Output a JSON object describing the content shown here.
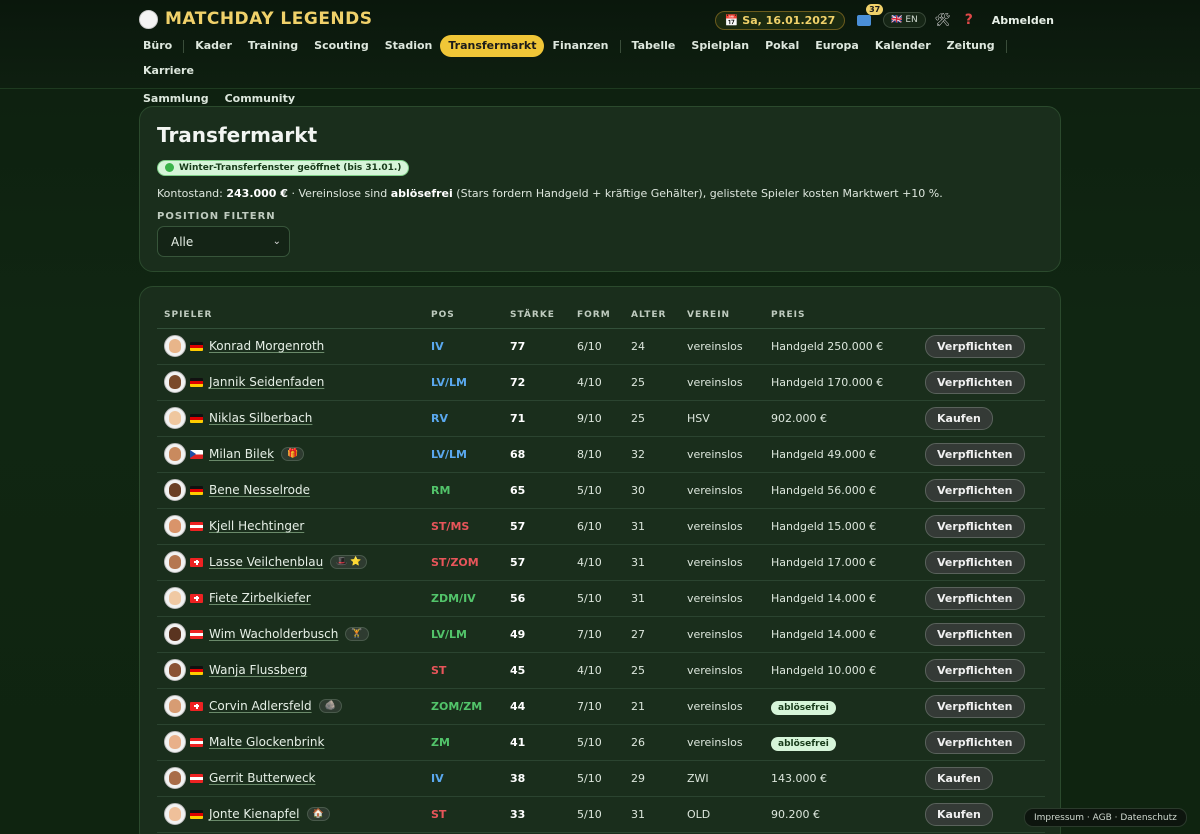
{
  "app": {
    "title": "MATCHDAY LEGENDS"
  },
  "topbar": {
    "date": "📅 Sa, 16.01.2027",
    "inbox_count": "37",
    "lang": "🇬🇧 EN",
    "logout": "Abmelden"
  },
  "nav": {
    "row1": [
      "Büro",
      "Kader",
      "Training",
      "Scouting",
      "Stadion",
      "Transfermarkt",
      "Finanzen",
      "Tabelle",
      "Spielplan",
      "Pokal",
      "Europa",
      "Kalender",
      "Zeitung",
      "Karriere"
    ],
    "row2": [
      "Sammlung",
      "Community"
    ],
    "active": "Transfermarkt"
  },
  "header": {
    "title": "Transfermarkt",
    "window_badge": "Winter-Transferfenster geöffnet (bis 31.01.)",
    "info_prefix": "Kontostand: ",
    "balance": "243.000 €",
    "info_mid": " · Vereinslose sind ",
    "free_word": "ablösefrei",
    "info_suffix": " (Stars fordern Handgeld + kräftige Gehälter), gelistete Spieler kosten Marktwert +10 %.",
    "filter_label": "POSITION FILTERN",
    "filter_value": "Alle"
  },
  "table": {
    "columns": [
      "SPIELER",
      "POS",
      "STÄRKE",
      "FORM",
      "ALTER",
      "VEREIN",
      "PREIS"
    ],
    "rows": [
      {
        "name": "Konrad Morgenroth",
        "flag": "de",
        "tag": "",
        "pos": "IV",
        "pos_color": "blue",
        "strength": "77",
        "form": "6/10",
        "age": "24",
        "club": "vereinslos",
        "price": "Handgeld 250.000 €",
        "price_badge": false,
        "action": "Verpflichten",
        "skin": "#e8b58a"
      },
      {
        "name": "Jannik Seidenfaden",
        "flag": "de",
        "tag": "",
        "pos": "LV/LM",
        "pos_color": "blue",
        "strength": "72",
        "form": "4/10",
        "age": "25",
        "club": "vereinslos",
        "price": "Handgeld 170.000 €",
        "price_badge": false,
        "action": "Verpflichten",
        "skin": "#7a4a2a"
      },
      {
        "name": "Niklas Silberbach",
        "flag": "de",
        "tag": "",
        "pos": "RV",
        "pos_color": "blue",
        "strength": "71",
        "form": "9/10",
        "age": "25",
        "club": "HSV",
        "price": "902.000 €",
        "price_badge": false,
        "action": "Kaufen",
        "skin": "#efc79f"
      },
      {
        "name": "Milan Bilek",
        "flag": "cz",
        "tag": "🎁",
        "pos": "LV/LM",
        "pos_color": "blue",
        "strength": "68",
        "form": "8/10",
        "age": "32",
        "club": "vereinslos",
        "price": "Handgeld 49.000 €",
        "price_badge": false,
        "action": "Verpflichten",
        "skin": "#c98a5e"
      },
      {
        "name": "Bene Nesselrode",
        "flag": "de",
        "tag": "",
        "pos": "RM",
        "pos_color": "green",
        "strength": "65",
        "form": "5/10",
        "age": "30",
        "club": "vereinslos",
        "price": "Handgeld 56.000 €",
        "price_badge": false,
        "action": "Verpflichten",
        "skin": "#6b3f25"
      },
      {
        "name": "Kjell Hechtinger",
        "flag": "at",
        "tag": "",
        "pos": "ST/MS",
        "pos_color": "red",
        "strength": "57",
        "form": "6/10",
        "age": "31",
        "club": "vereinslos",
        "price": "Handgeld 15.000 €",
        "price_badge": false,
        "action": "Verpflichten",
        "skin": "#d9946a"
      },
      {
        "name": "Lasse Veilchenblau",
        "flag": "ch",
        "tag": "🎩 ⭐",
        "pos": "ST/ZOM",
        "pos_color": "red",
        "strength": "57",
        "form": "4/10",
        "age": "31",
        "club": "vereinslos",
        "price": "Handgeld 17.000 €",
        "price_badge": false,
        "action": "Verpflichten",
        "skin": "#b57750"
      },
      {
        "name": "Fiete Zirbelkiefer",
        "flag": "ch",
        "tag": "",
        "pos": "ZDM/IV",
        "pos_color": "green",
        "strength": "56",
        "form": "5/10",
        "age": "31",
        "club": "vereinslos",
        "price": "Handgeld 14.000 €",
        "price_badge": false,
        "action": "Verpflichten",
        "skin": "#f0c9a3"
      },
      {
        "name": "Wim Wacholderbusch",
        "flag": "at",
        "tag": "🏋",
        "pos": "LV/LM",
        "pos_color": "green",
        "strength": "49",
        "form": "7/10",
        "age": "27",
        "club": "vereinslos",
        "price": "Handgeld 14.000 €",
        "price_badge": false,
        "action": "Verpflichten",
        "skin": "#5a3420"
      },
      {
        "name": "Wanja Flussberg",
        "flag": "de",
        "tag": "",
        "pos": "ST",
        "pos_color": "red",
        "strength": "45",
        "form": "4/10",
        "age": "25",
        "club": "vereinslos",
        "price": "Handgeld 10.000 €",
        "price_badge": false,
        "action": "Verpflichten",
        "skin": "#8a5234"
      },
      {
        "name": "Corvin Adlersfeld",
        "flag": "ch",
        "tag": "🪨",
        "pos": "ZOM/ZM",
        "pos_color": "green",
        "strength": "44",
        "form": "7/10",
        "age": "21",
        "club": "vereinslos",
        "price": "ablösefrei",
        "price_badge": true,
        "action": "Verpflichten",
        "skin": "#d79c73"
      },
      {
        "name": "Malte Glockenbrink",
        "flag": "at",
        "tag": "",
        "pos": "ZM",
        "pos_color": "green",
        "strength": "41",
        "form": "5/10",
        "age": "26",
        "club": "vereinslos",
        "price": "ablösefrei",
        "price_badge": true,
        "action": "Verpflichten",
        "skin": "#e8b08a"
      },
      {
        "name": "Gerrit Butterweck",
        "flag": "at",
        "tag": "",
        "pos": "IV",
        "pos_color": "blue",
        "strength": "38",
        "form": "5/10",
        "age": "29",
        "club": "ZWI",
        "price": "143.000 €",
        "price_badge": false,
        "action": "Kaufen",
        "skin": "#a86c48"
      },
      {
        "name": "Jonte Kienapfel",
        "flag": "de",
        "tag": "🏠",
        "pos": "ST",
        "pos_color": "red",
        "strength": "33",
        "form": "5/10",
        "age": "31",
        "club": "OLD",
        "price": "90.200 €",
        "price_badge": false,
        "action": "Kaufen",
        "skin": "#efc09a"
      }
    ]
  },
  "footer": {
    "links": "Impressum · AGB · Datenschutz"
  }
}
